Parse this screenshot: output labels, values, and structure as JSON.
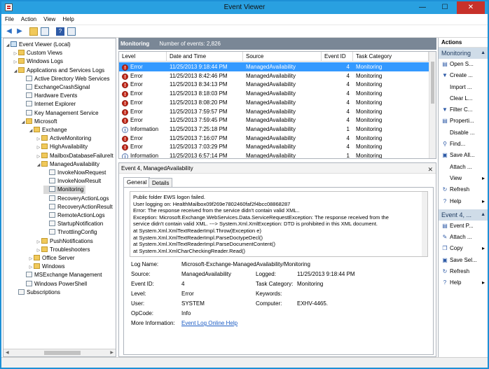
{
  "window": {
    "title": "Event Viewer",
    "minimize": "—",
    "maximize": "☐",
    "close": "✕"
  },
  "menu": [
    "File",
    "Action",
    "View",
    "Help"
  ],
  "tree": [
    {
      "label": "Event Viewer (Local)",
      "depth": 0,
      "tw": "◢",
      "icon": "computer-icon"
    },
    {
      "label": "Custom Views",
      "depth": 1,
      "tw": "▷",
      "icon": "folder-icon"
    },
    {
      "label": "Windows Logs",
      "depth": 1,
      "tw": "▷",
      "icon": "folder-icon"
    },
    {
      "label": "Applications and Services Logs",
      "depth": 1,
      "tw": "◢",
      "icon": "folder-icon"
    },
    {
      "label": "Active Directory Web Services",
      "depth": 2,
      "tw": "",
      "icon": "log-icon"
    },
    {
      "label": "ExchangeCrashSignal",
      "depth": 2,
      "tw": "",
      "icon": "log-icon"
    },
    {
      "label": "Hardware Events",
      "depth": 2,
      "tw": "",
      "icon": "log-icon"
    },
    {
      "label": "Internet Explorer",
      "depth": 2,
      "tw": "",
      "icon": "log-icon"
    },
    {
      "label": "Key Management Service",
      "depth": 2,
      "tw": "",
      "icon": "log-icon"
    },
    {
      "label": "Microsoft",
      "depth": 2,
      "tw": "◢",
      "icon": "folder-icon"
    },
    {
      "label": "Exchange",
      "depth": 3,
      "tw": "◢",
      "icon": "folder-icon"
    },
    {
      "label": "ActiveMonitoring",
      "depth": 4,
      "tw": "▷",
      "icon": "folder-icon"
    },
    {
      "label": "HighAvailability",
      "depth": 4,
      "tw": "▷",
      "icon": "folder-icon"
    },
    {
      "label": "MailboxDatabaseFailureIt",
      "depth": 4,
      "tw": "▷",
      "icon": "folder-icon"
    },
    {
      "label": "ManagedAvailability",
      "depth": 4,
      "tw": "◢",
      "icon": "folder-icon"
    },
    {
      "label": "InvokeNowRequest",
      "depth": 5,
      "tw": "",
      "icon": "log-icon"
    },
    {
      "label": "InvokeNowResult",
      "depth": 5,
      "tw": "",
      "icon": "log-icon"
    },
    {
      "label": "Monitoring",
      "depth": 5,
      "tw": "",
      "icon": "log-icon",
      "selected": true
    },
    {
      "label": "RecoveryActionLogs",
      "depth": 5,
      "tw": "",
      "icon": "log-icon"
    },
    {
      "label": "RecoveryActionResult",
      "depth": 5,
      "tw": "",
      "icon": "log-icon"
    },
    {
      "label": "RemoteActionLogs",
      "depth": 5,
      "tw": "",
      "icon": "log-icon"
    },
    {
      "label": "StartupNotification",
      "depth": 5,
      "tw": "",
      "icon": "log-icon"
    },
    {
      "label": "ThrottlingConfig",
      "depth": 5,
      "tw": "",
      "icon": "log-icon"
    },
    {
      "label": "PushNotifications",
      "depth": 4,
      "tw": "▷",
      "icon": "folder-icon"
    },
    {
      "label": "Troubleshooters",
      "depth": 4,
      "tw": "▷",
      "icon": "folder-icon"
    },
    {
      "label": "Office Server",
      "depth": 3,
      "tw": "▷",
      "icon": "folder-icon"
    },
    {
      "label": "Windows",
      "depth": 3,
      "tw": "▷",
      "icon": "folder-icon"
    },
    {
      "label": "MSExchange Management",
      "depth": 2,
      "tw": "",
      "icon": "log-icon"
    },
    {
      "label": "Windows PowerShell",
      "depth": 2,
      "tw": "",
      "icon": "log-icon"
    },
    {
      "label": "Subscriptions",
      "depth": 1,
      "tw": "",
      "icon": "log-icon"
    }
  ],
  "log_header": {
    "name": "Monitoring",
    "count": "Number of events: 2,826"
  },
  "columns": [
    "Level",
    "Date and Time",
    "Source",
    "Event ID",
    "Task Category"
  ],
  "events": [
    {
      "level": "Error",
      "date": "11/25/2013 9:18:44 PM",
      "source": "ManagedAvailability",
      "id": "4",
      "category": "Monitoring",
      "selected": true
    },
    {
      "level": "Error",
      "date": "11/25/2013 8:42:46 PM",
      "source": "ManagedAvailability",
      "id": "4",
      "category": "Monitoring"
    },
    {
      "level": "Error",
      "date": "11/25/2013 8:34:13 PM",
      "source": "ManagedAvailability",
      "id": "4",
      "category": "Monitoring"
    },
    {
      "level": "Error",
      "date": "11/25/2013 8:18:03 PM",
      "source": "ManagedAvailability",
      "id": "4",
      "category": "Monitoring"
    },
    {
      "level": "Error",
      "date": "11/25/2013 8:08:20 PM",
      "source": "ManagedAvailability",
      "id": "4",
      "category": "Monitoring"
    },
    {
      "level": "Error",
      "date": "11/25/2013 7:59:57 PM",
      "source": "ManagedAvailability",
      "id": "4",
      "category": "Monitoring"
    },
    {
      "level": "Error",
      "date": "11/25/2013 7:59:45 PM",
      "source": "ManagedAvailability",
      "id": "4",
      "category": "Monitoring"
    },
    {
      "level": "Information",
      "date": "11/25/2013 7:25:18 PM",
      "source": "ManagedAvailability",
      "id": "1",
      "category": "Monitoring"
    },
    {
      "level": "Error",
      "date": "11/25/2013 7:16:07 PM",
      "source": "ManagedAvailability",
      "id": "4",
      "category": "Monitoring"
    },
    {
      "level": "Error",
      "date": "11/25/2013 7:03:29 PM",
      "source": "ManagedAvailability",
      "id": "4",
      "category": "Monitoring"
    },
    {
      "level": "Information",
      "date": "11/25/2013 6:57:14 PM",
      "source": "ManagedAvailability",
      "id": "1",
      "category": "Monitoring"
    }
  ],
  "detail": {
    "title": "Event 4, ManagedAvailability",
    "close": "✕",
    "tabs": [
      "General",
      "Details"
    ],
    "message": [
      "Public folder EWS logon failed.",
      " User logging on: HealthMailbox09f269e7802460faf2f4bcc08868287",
      " Error: The response received from the service didn't contain valid XML..",
      "Exception: Microsoft.Exchange.WebServices.Data.ServiceRequestException: The response received from the",
      "service didn't contain valid XML. ---> System.Xml.XmlException: DTD is prohibited in this XML document.",
      "   at System.Xml.XmlTextReaderImpl.Throw(Exception e)",
      "   at System.Xml.XmlTextReaderImpl.ParseDoctypeDecl()",
      "   at System.Xml.XmlTextReaderImpl.ParseDocumentContent()",
      "   at System.Xml.XmlCharCheckingReader.Read()"
    ],
    "props": {
      "log_name_label": "Log Name:",
      "log_name": "Microsoft-Exchange-ManagedAvailability/Monitoring",
      "source_label": "Source:",
      "source": "ManagedAvailability",
      "logged_label": "Logged:",
      "logged": "11/25/2013 9:18:44 PM",
      "event_id_label": "Event ID:",
      "event_id": "4",
      "task_label": "Task Category:",
      "task": "Monitoring",
      "level_label": "Level:",
      "level": "Error",
      "keywords_label": "Keywords:",
      "keywords": "",
      "user_label": "User:",
      "user": "SYSTEM",
      "computer_label": "Computer:",
      "computer": "EXHV-4465.",
      "opcode_label": "OpCode:",
      "opcode": "Info",
      "more_label": "More Information:",
      "more_link": "Event Log Online Help"
    }
  },
  "actions": {
    "title": "Actions",
    "sections": [
      {
        "name": "Monitoring",
        "items": [
          {
            "label": "Open S...",
            "icon": "open-icon",
            "glyph": "▤"
          },
          {
            "label": "Create ...",
            "icon": "filter-icon",
            "glyph": "▼"
          },
          {
            "label": "Import ...",
            "icon": "import-icon",
            "glyph": ""
          },
          {
            "label": "Clear L...",
            "icon": "clear-icon",
            "glyph": ""
          },
          {
            "label": "Filter C...",
            "icon": "filter-icon",
            "glyph": "▼"
          },
          {
            "label": "Properti...",
            "icon": "properties-icon",
            "glyph": "▤"
          },
          {
            "label": "Disable ...",
            "icon": "disable-icon",
            "glyph": ""
          },
          {
            "label": "Find...",
            "icon": "find-icon",
            "glyph": "⚲"
          },
          {
            "label": "Save All...",
            "icon": "save-icon",
            "glyph": "▣"
          },
          {
            "label": "Attach ...",
            "icon": "attach-icon",
            "glyph": ""
          },
          {
            "label": "View",
            "icon": "view-icon",
            "glyph": "",
            "arrow": "▸"
          },
          {
            "label": "Refresh",
            "icon": "refresh-icon",
            "glyph": "↻"
          },
          {
            "label": "Help",
            "icon": "help-icon",
            "glyph": "?",
            "arrow": "▸"
          }
        ]
      },
      {
        "name": "Event 4, ...",
        "items": [
          {
            "label": "Event P...",
            "icon": "event-properties-icon",
            "glyph": "▤"
          },
          {
            "label": "Attach ...",
            "icon": "attach-icon",
            "glyph": "✎"
          },
          {
            "label": "Copy",
            "icon": "copy-icon",
            "glyph": "❐",
            "arrow": "▸"
          },
          {
            "label": "Save Sel...",
            "icon": "save-icon",
            "glyph": "▣"
          },
          {
            "label": "Refresh",
            "icon": "refresh-icon",
            "glyph": "↻"
          },
          {
            "label": "Help",
            "icon": "help-icon",
            "glyph": "?",
            "arrow": "▸"
          }
        ]
      }
    ]
  }
}
